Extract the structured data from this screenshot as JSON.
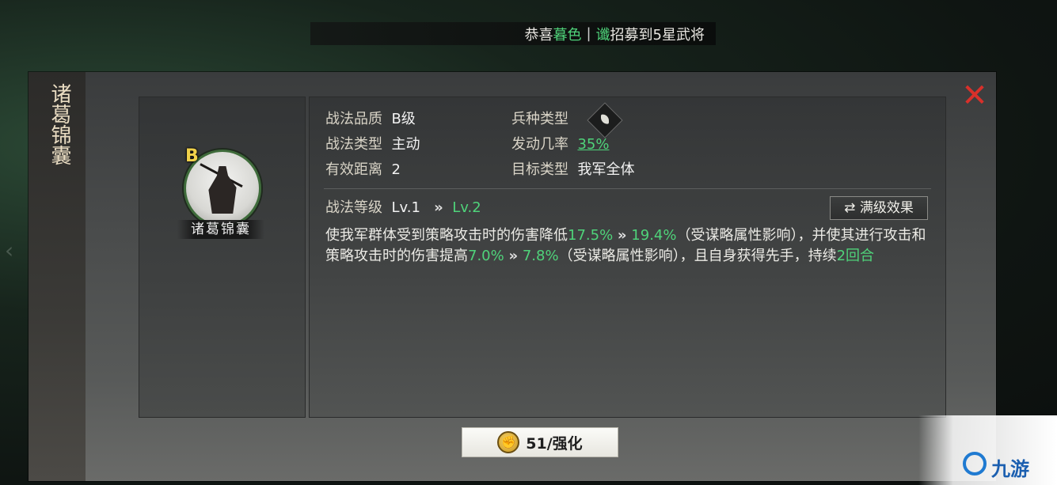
{
  "banner": {
    "prefix": "恭喜",
    "player": "暮色",
    "separator": "|",
    "hero_char": "谶",
    "message": "招募到5星武将"
  },
  "panel": {
    "title": "诸葛锦囊",
    "close_icon": "close-icon"
  },
  "skill": {
    "grade_badge": "B",
    "name": "诸葛锦囊"
  },
  "info": {
    "quality_label": "战法品质",
    "quality_value": "B级",
    "unit_type_label": "兵种类型",
    "unit_type_icon": "cavalry-icon",
    "type_label": "战法类型",
    "type_value": "主动",
    "rate_label": "发动几率",
    "rate_value": "35%",
    "range_label": "有效距离",
    "range_value": "2",
    "target_label": "目标类型",
    "target_value": "我军全体"
  },
  "level": {
    "label": "战法等级",
    "current": "Lv.1",
    "arrow": "»",
    "next": "Lv.2",
    "max_button": "满级效果"
  },
  "description": {
    "p1": "使我军群体受到策略攻击时的伤害降低",
    "v1a": "17.5%",
    "arrow": "»",
    "v1b": "19.4%",
    "p2": "（受谋略属性影响），并使其进行攻击和策略攻击时的伤害提高",
    "v2a": "7.0%",
    "v2b": "7.8%",
    "p3": "（受谋略属性影响），且自身获得先手，持续",
    "v3": "2回合"
  },
  "upgrade": {
    "label": "51/强化"
  },
  "watermark": {
    "text": "九游"
  },
  "colors": {
    "accent_green": "#4fd37a",
    "close_red": "#d9302a",
    "grade_gold": "#f0d14a"
  }
}
